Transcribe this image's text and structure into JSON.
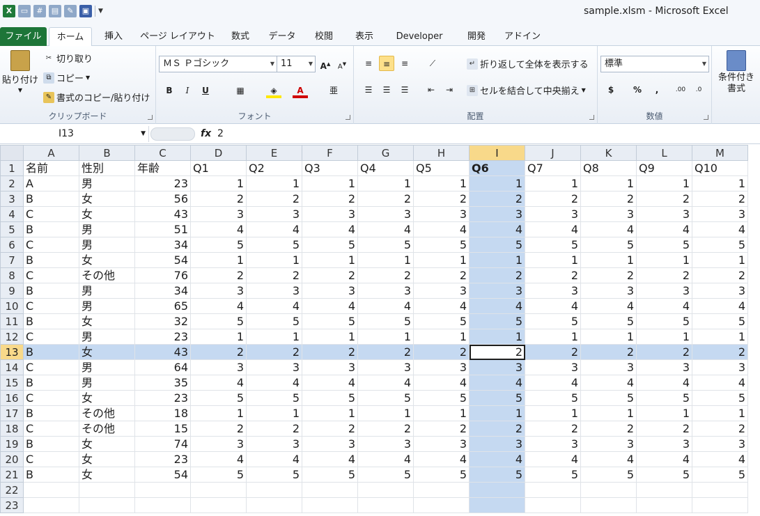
{
  "window": {
    "title": "sample.xlsm - Microsoft Excel"
  },
  "qat": {
    "icons": [
      "excel-icon",
      "new-icon",
      "calc-icon",
      "paste-icon",
      "macro-icon",
      "save-icon"
    ]
  },
  "tabs": [
    {
      "label": "ファイル"
    },
    {
      "label": "ホーム"
    },
    {
      "label": "挿入"
    },
    {
      "label": "ページ レイアウト"
    },
    {
      "label": "数式"
    },
    {
      "label": "データ"
    },
    {
      "label": "校閲"
    },
    {
      "label": "表示"
    },
    {
      "label": "Developer"
    },
    {
      "label": "開発"
    },
    {
      "label": "アドイン"
    }
  ],
  "ribbon": {
    "clipboard": {
      "paste": "貼り付け",
      "cut": "切り取り",
      "copy": "コピー",
      "format_copy": "書式のコピー/貼り付け",
      "label": "クリップボード"
    },
    "font": {
      "name": "ＭＳ Ｐゴシック",
      "size": "11",
      "label": "フォント",
      "bold": "B",
      "italic": "I",
      "underline": "U"
    },
    "alignment": {
      "wrap": "折り返して全体を表示する",
      "merge": "セルを結合して中央揃え",
      "label": "配置"
    },
    "number": {
      "format": "標準",
      "currency": "$",
      "percent": "%",
      "comma": ",",
      "label": "数値"
    },
    "styles": {
      "conditional": "条件付き書式"
    }
  },
  "formula_bar": {
    "name_box": "I13",
    "fx": "fx",
    "value": "2"
  },
  "columns": [
    "A",
    "B",
    "C",
    "D",
    "E",
    "F",
    "G",
    "H",
    "I",
    "J",
    "K",
    "L",
    "M"
  ],
  "header_row": [
    "名前",
    "性別",
    "年齢",
    "Q1",
    "Q2",
    "Q3",
    "Q4",
    "Q5",
    "Q6",
    "Q7",
    "Q8",
    "Q9",
    "Q10"
  ],
  "rows": [
    [
      "A",
      "男",
      "23",
      "1",
      "1",
      "1",
      "1",
      "1",
      "1",
      "1",
      "1",
      "1",
      "1"
    ],
    [
      "B",
      "女",
      "56",
      "2",
      "2",
      "2",
      "2",
      "2",
      "2",
      "2",
      "2",
      "2",
      "2"
    ],
    [
      "C",
      "女",
      "43",
      "3",
      "3",
      "3",
      "3",
      "3",
      "3",
      "3",
      "3",
      "3",
      "3"
    ],
    [
      "B",
      "男",
      "51",
      "4",
      "4",
      "4",
      "4",
      "4",
      "4",
      "4",
      "4",
      "4",
      "4"
    ],
    [
      "C",
      "男",
      "34",
      "5",
      "5",
      "5",
      "5",
      "5",
      "5",
      "5",
      "5",
      "5",
      "5"
    ],
    [
      "B",
      "女",
      "54",
      "1",
      "1",
      "1",
      "1",
      "1",
      "1",
      "1",
      "1",
      "1",
      "1"
    ],
    [
      "C",
      "その他",
      "76",
      "2",
      "2",
      "2",
      "2",
      "2",
      "2",
      "2",
      "2",
      "2",
      "2"
    ],
    [
      "B",
      "男",
      "34",
      "3",
      "3",
      "3",
      "3",
      "3",
      "3",
      "3",
      "3",
      "3",
      "3"
    ],
    [
      "C",
      "男",
      "65",
      "4",
      "4",
      "4",
      "4",
      "4",
      "4",
      "4",
      "4",
      "4",
      "4"
    ],
    [
      "B",
      "女",
      "32",
      "5",
      "5",
      "5",
      "5",
      "5",
      "5",
      "5",
      "5",
      "5",
      "5"
    ],
    [
      "C",
      "男",
      "23",
      "1",
      "1",
      "1",
      "1",
      "1",
      "1",
      "1",
      "1",
      "1",
      "1"
    ],
    [
      "B",
      "女",
      "43",
      "2",
      "2",
      "2",
      "2",
      "2",
      "2",
      "2",
      "2",
      "2",
      "2"
    ],
    [
      "C",
      "男",
      "64",
      "3",
      "3",
      "3",
      "3",
      "3",
      "3",
      "3",
      "3",
      "3",
      "3"
    ],
    [
      "B",
      "男",
      "35",
      "4",
      "4",
      "4",
      "4",
      "4",
      "4",
      "4",
      "4",
      "4",
      "4"
    ],
    [
      "C",
      "女",
      "23",
      "5",
      "5",
      "5",
      "5",
      "5",
      "5",
      "5",
      "5",
      "5",
      "5"
    ],
    [
      "B",
      "その他",
      "18",
      "1",
      "1",
      "1",
      "1",
      "1",
      "1",
      "1",
      "1",
      "1",
      "1"
    ],
    [
      "C",
      "その他",
      "15",
      "2",
      "2",
      "2",
      "2",
      "2",
      "2",
      "2",
      "2",
      "2",
      "2"
    ],
    [
      "B",
      "女",
      "74",
      "3",
      "3",
      "3",
      "3",
      "3",
      "3",
      "3",
      "3",
      "3",
      "3"
    ],
    [
      "C",
      "女",
      "23",
      "4",
      "4",
      "4",
      "4",
      "4",
      "4",
      "4",
      "4",
      "4",
      "4"
    ],
    [
      "B",
      "女",
      "54",
      "5",
      "5",
      "5",
      "5",
      "5",
      "5",
      "5",
      "5",
      "5",
      "5"
    ],
    [
      "",
      "",
      "",
      "",
      "",
      "",
      "",
      "",
      "",
      "",
      "",
      "",
      ""
    ],
    [
      "",
      "",
      "",
      "",
      "",
      "",
      "",
      "",
      "",
      "",
      "",
      "",
      ""
    ]
  ],
  "selection": {
    "column": "I",
    "row": "13"
  },
  "colors": {
    "selection": "#c5d9f1",
    "header_highlight": "#f8d98a",
    "file_tab": "#1d7538"
  }
}
